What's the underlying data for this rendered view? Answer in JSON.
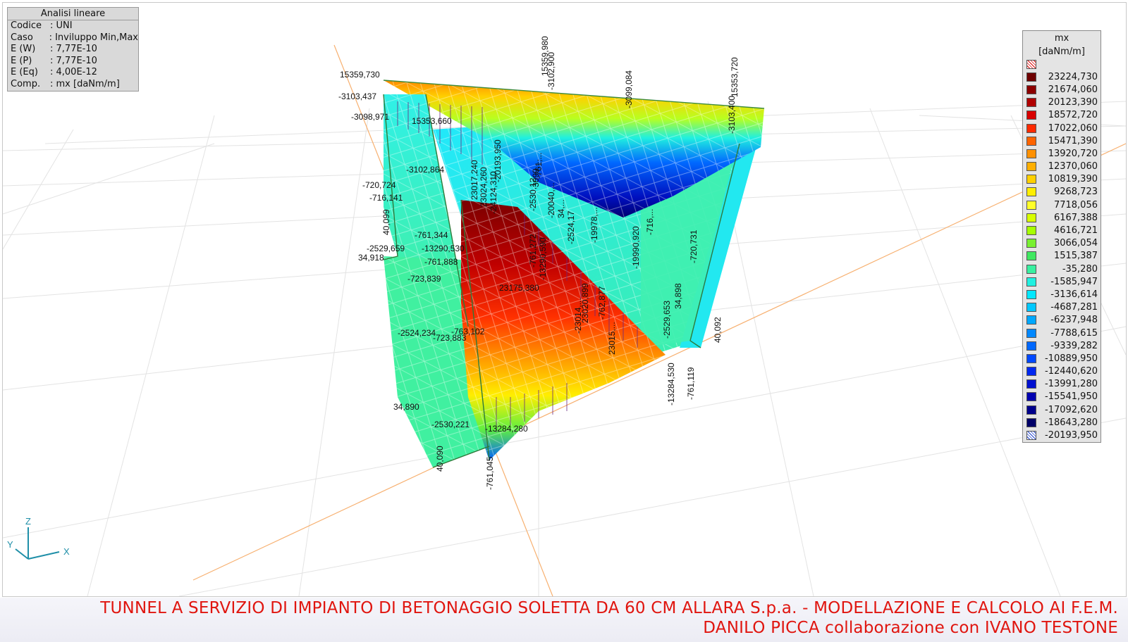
{
  "info_panel": {
    "title": "Analisi lineare",
    "rows": [
      {
        "key": "Codice",
        "value": ": UNI"
      },
      {
        "key": "Caso",
        "value": ": Inviluppo Min,Max"
      },
      {
        "key": "E (W)",
        "value": ": 7,77E-10"
      },
      {
        "key": "E (P)",
        "value": ": 7,77E-10"
      },
      {
        "key": "E (Eq)",
        "value": ": 4,00E-12"
      },
      {
        "key": "Comp.",
        "value": ": mx [daNm/m]"
      }
    ]
  },
  "legend": {
    "title": "mx",
    "unit": "[daNm/m]",
    "entries": [
      {
        "value": "",
        "color": "hatch-red"
      },
      {
        "value": "23224,730",
        "color": "#6e0000"
      },
      {
        "value": "21674,060",
        "color": "#8c0000"
      },
      {
        "value": "20123,390",
        "color": "#b00000"
      },
      {
        "value": "18572,720",
        "color": "#d80000"
      },
      {
        "value": "17022,060",
        "color": "#ff2a00"
      },
      {
        "value": "15471,390",
        "color": "#ff6400"
      },
      {
        "value": "13920,720",
        "color": "#ff9000"
      },
      {
        "value": "12370,060",
        "color": "#ffaf00"
      },
      {
        "value": "10819,390",
        "color": "#ffd000"
      },
      {
        "value": "9268,723",
        "color": "#ffee00"
      },
      {
        "value": "7718,056",
        "color": "#ffff2a"
      },
      {
        "value": "6167,388",
        "color": "#d8ff00"
      },
      {
        "value": "4616,721",
        "color": "#a6ff00"
      },
      {
        "value": "3066,054",
        "color": "#78f030"
      },
      {
        "value": "1515,387",
        "color": "#40e860"
      },
      {
        "value": "-35,280",
        "color": "#38f0a0"
      },
      {
        "value": "-1585,947",
        "color": "#20f0e0"
      },
      {
        "value": "-3136,614",
        "color": "#00e8ff"
      },
      {
        "value": "-4687,281",
        "color": "#00c8ff"
      },
      {
        "value": "-6237,948",
        "color": "#00a8ff"
      },
      {
        "value": "-7788,615",
        "color": "#0088ff"
      },
      {
        "value": "-9339,282",
        "color": "#0068ff"
      },
      {
        "value": "-10889,950",
        "color": "#0048ff"
      },
      {
        "value": "-12440,620",
        "color": "#0028f0"
      },
      {
        "value": "-13991,280",
        "color": "#0010d0"
      },
      {
        "value": "-15541,950",
        "color": "#0000b0"
      },
      {
        "value": "-17092,620",
        "color": "#00008c"
      },
      {
        "value": "-18643,280",
        "color": "#000068"
      },
      {
        "value": "-20193,950",
        "color": "hatch-blue"
      }
    ]
  },
  "model_labels": [
    {
      "text": "15359,730"
    },
    {
      "text": "-3103,437"
    },
    {
      "text": "-3098,971"
    },
    {
      "text": "15353,660"
    },
    {
      "text": "-3102,864"
    },
    {
      "text": "-720,724"
    },
    {
      "text": "-716,141"
    },
    {
      "text": "40,099"
    },
    {
      "text": "-761,344"
    },
    {
      "text": "-2529,659"
    },
    {
      "text": "-13290,530"
    },
    {
      "text": "34,918"
    },
    {
      "text": "-761,888"
    },
    {
      "text": "-723,839"
    },
    {
      "text": "23175,380"
    },
    {
      "text": "-2524,234"
    },
    {
      "text": "-763,102"
    },
    {
      "text": "-723,883"
    },
    {
      "text": "34,890"
    },
    {
      "text": "-2530,221"
    },
    {
      "text": "-13284,280"
    },
    {
      "text": "40,090"
    },
    {
      "text": "-761,045"
    },
    {
      "text": "15359,980"
    },
    {
      "text": "-3102,900"
    },
    {
      "text": "-3099,084"
    },
    {
      "text": "15353,720"
    },
    {
      "text": "-3103,400"
    },
    {
      "text": "23017,240"
    },
    {
      "text": "23024,260"
    },
    {
      "text": "-24124,310"
    },
    {
      "text": "-20193,950"
    },
    {
      "text": "-19990,920"
    },
    {
      "text": "-716,..."
    },
    {
      "text": "-720,731"
    },
    {
      "text": "-2529,653"
    },
    {
      "text": "34,898"
    },
    {
      "text": "40,092"
    },
    {
      "text": "-13284,530"
    },
    {
      "text": "-761,119"
    },
    {
      "text": "-2524,17"
    },
    {
      "text": "-19978,..."
    },
    {
      "text": "-20040,..."
    },
    {
      "text": "-2530,12"
    },
    {
      "text": "-13290,590"
    },
    {
      "text": "-761,272"
    },
    {
      "text": "23020,899"
    },
    {
      "text": "23015,..."
    },
    {
      "text": "-762,877"
    },
    {
      "text": "-23014,..."
    },
    {
      "text": "-761,..."
    },
    {
      "text": "3099,..."
    },
    {
      "text": "34,..."
    }
  ],
  "axis": {
    "z": "Z",
    "y": "Y",
    "x": "X"
  },
  "footer": {
    "line1": "TUNNEL A SERVIZIO DI IMPIANTO DI BETONAGGIO SOLETTA DA 60 CM ALLARA S.p.a. - MODELLAZIONE E CALCOLO AI F.E.M.",
    "line2": "DANILO PICCA collaborazione con IVANO TESTONE"
  }
}
